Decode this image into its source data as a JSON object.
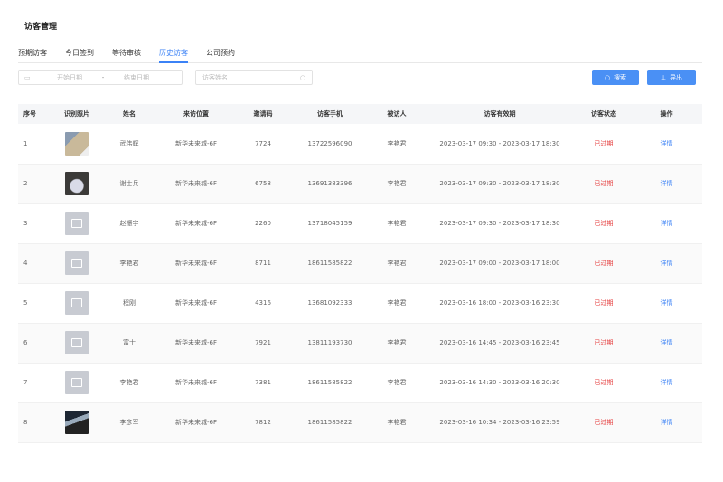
{
  "page": {
    "title": "访客管理"
  },
  "tabs": [
    {
      "label": "预期访客"
    },
    {
      "label": "今日签到"
    },
    {
      "label": "等待审核"
    },
    {
      "label": "历史访客",
      "active": true
    },
    {
      "label": "公司预约"
    }
  ],
  "filters": {
    "start_placeholder": "开始日期",
    "separator": "-",
    "end_placeholder": "结束日期",
    "name_placeholder": "访客姓名"
  },
  "buttons": {
    "search": "搜索",
    "export": "导出"
  },
  "colors": {
    "accent": "#4a90f5",
    "expired": "#e53e3e"
  },
  "table": {
    "headers": [
      "序号",
      "识别照片",
      "姓名",
      "来访位置",
      "邀请码",
      "访客手机",
      "被访人",
      "访客有效期",
      "访客状态",
      "操作"
    ],
    "rows": [
      {
        "no": "1",
        "photo": "photo",
        "name": "武伟辉",
        "location": "新华未来城-6F",
        "code": "7724",
        "phone": "13722596090",
        "host": "李艳君",
        "period": "2023-03-17 09:30 - 2023-03-17 18:30",
        "status": "已过期",
        "action": "详情"
      },
      {
        "no": "2",
        "photo": "photo",
        "name": "谢士兵",
        "location": "新华未来城-6F",
        "code": "6758",
        "phone": "13691383396",
        "host": "李艳君",
        "period": "2023-03-17 09:30 - 2023-03-17 18:30",
        "status": "已过期",
        "action": "详情"
      },
      {
        "no": "3",
        "photo": "placeholder",
        "name": "赵振宇",
        "location": "新华未来城-6F",
        "code": "2260",
        "phone": "13718045159",
        "host": "李艳君",
        "period": "2023-03-17 09:30 - 2023-03-17 18:30",
        "status": "已过期",
        "action": "详情"
      },
      {
        "no": "4",
        "photo": "placeholder",
        "name": "李艳君",
        "location": "新华未来城-6F",
        "code": "8711",
        "phone": "18611585822",
        "host": "李艳君",
        "period": "2023-03-17 09:00 - 2023-03-17 18:00",
        "status": "已过期",
        "action": "详情"
      },
      {
        "no": "5",
        "photo": "placeholder",
        "name": "程刚",
        "location": "新华未来城-6F",
        "code": "4316",
        "phone": "13681092333",
        "host": "李艳君",
        "period": "2023-03-16 18:00 - 2023-03-16 23:30",
        "status": "已过期",
        "action": "详情"
      },
      {
        "no": "6",
        "photo": "placeholder",
        "name": "富士",
        "location": "新华未来城-6F",
        "code": "7921",
        "phone": "13811193730",
        "host": "李艳君",
        "period": "2023-03-16 14:45 - 2023-03-16 23:45",
        "status": "已过期",
        "action": "详情"
      },
      {
        "no": "7",
        "photo": "placeholder",
        "name": "李艳君",
        "location": "新华未来城-6F",
        "code": "7381",
        "phone": "18611585822",
        "host": "李艳君",
        "period": "2023-03-16 14:30 - 2023-03-16 20:30",
        "status": "已过期",
        "action": "详情"
      },
      {
        "no": "8",
        "photo": "photo",
        "name": "李彦军",
        "location": "新华未来城-6F",
        "code": "7812",
        "phone": "18611585822",
        "host": "李艳君",
        "period": "2023-03-16 10:34 - 2023-03-16 23:59",
        "status": "已过期",
        "action": "详情"
      }
    ]
  }
}
